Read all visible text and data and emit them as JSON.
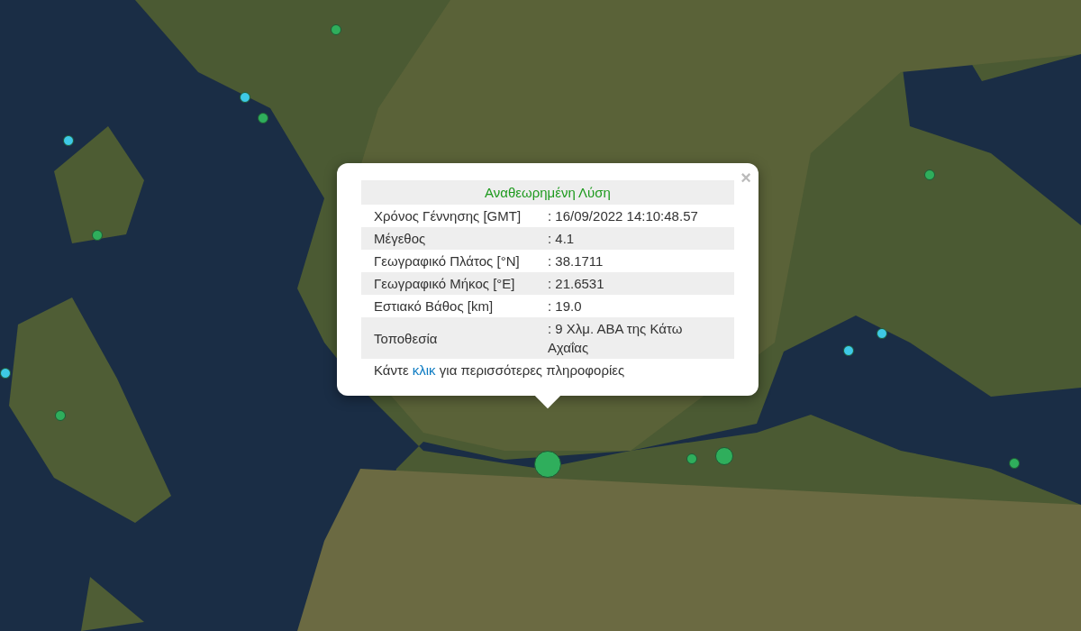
{
  "map": {
    "markers": [
      {
        "color": "#2fae5c",
        "kind": "small"
      },
      {
        "color": "#3ec9e6",
        "kind": "small"
      },
      {
        "color": "#2fae5c",
        "kind": "small"
      },
      {
        "color": "#3ec9e6",
        "kind": "small"
      },
      {
        "color": "#2fae5c",
        "kind": "small"
      },
      {
        "color": "#3ec9e6",
        "kind": "small"
      },
      {
        "color": "#2fae5c",
        "kind": "small"
      },
      {
        "color": "#2fae5c",
        "kind": "small"
      },
      {
        "color": "#3ec9e6",
        "kind": "small"
      },
      {
        "color": "#3ec9e6",
        "kind": "small"
      },
      {
        "color": "#2fae5c",
        "kind": "small"
      },
      {
        "color": "#2fae5c",
        "kind": "medium"
      },
      {
        "color": "#2fae5c",
        "kind": "large"
      },
      {
        "color": "#2fae5c",
        "kind": "small"
      }
    ]
  },
  "popup": {
    "close": "×",
    "title": "Αναθεωρημένη Λύση",
    "rows": [
      {
        "label": "Χρόνος Γέννησης [GMT]",
        "value": ": 16/09/2022 14:10:48.57"
      },
      {
        "label": "Μέγεθος",
        "value": ": 4.1"
      },
      {
        "label": "Γεωγραφικό Πλάτος [°N]",
        "value": ": 38.1711"
      },
      {
        "label": "Γεωγραφικό Μήκος [°E]",
        "value": ": 21.6531"
      },
      {
        "label": "Εστιακό Βάθος [km]",
        "value": ": 19.0"
      },
      {
        "label": "Τοποθεσία",
        "value": ": 9 Χλμ. ΑΒΑ της Κάτω Αχαΐας"
      }
    ],
    "footer": {
      "before": "Κάντε",
      "link": "κλικ",
      "after": "για περισσότερες πληροφορίες"
    }
  }
}
